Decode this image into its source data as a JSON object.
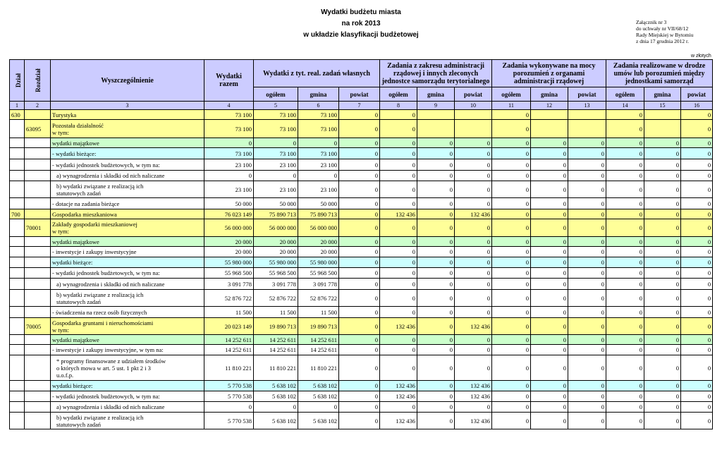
{
  "header": {
    "title_line1": "Wydatki budżetu miasta",
    "title_line2": "na rok 2013",
    "title_line3": "w układzie klasyfikacji budżetowej",
    "annex_line1": "Załącznik nr 3",
    "annex_line2": "do uchwały nr VII/68/12",
    "annex_line3": "Rady Miejskiej w Bytomiu",
    "annex_line4": "z dnia 17 grudnia 2012 r.",
    "unit": "w złotych"
  },
  "table": {
    "col_dzial": "Dział",
    "col_rozdzial": "Rozdział",
    "col_desc": "Wyszczególnienie",
    "col_total": "Wydatki razem",
    "group_own": "Wydatki z tyt. real. zadań własnych",
    "group_admin": "Zadania z zakresu administracji rządowej i innych zleconych jednostce samorządu terytorialnego",
    "group_agreements": "Zadania wykonywane na mocy porozumień z organami administracji rządowej",
    "group_jst": "Zadania realizowane w drodze umów lub porozumień między jednostkami samorząd",
    "sub_total": "ogółem",
    "sub_gmina": "gmina",
    "sub_powiat": "powiat",
    "col_numbers": [
      "1",
      "2",
      "3",
      "4",
      "5",
      "6",
      "7",
      "8",
      "9",
      "10",
      "11",
      "12",
      "13",
      "14",
      "15",
      "16"
    ]
  },
  "rows": [
    {
      "style": "y",
      "dzial": "630",
      "rozdzial": "",
      "desc": "Turystyka",
      "v": [
        "73 100",
        "73 100",
        "73 100",
        "0",
        "0",
        "",
        "",
        "0",
        "",
        "",
        "0",
        "",
        "0"
      ],
      "h": 14
    },
    {
      "style": "y",
      "dzial": "",
      "rozdzial": "63095",
      "desc": "Pozostała działalność\nw tym:",
      "v": [
        "73 100",
        "73 100",
        "73 100",
        "0",
        "0",
        "",
        "",
        "0",
        "",
        "",
        "0",
        "",
        "0"
      ],
      "h": 26
    },
    {
      "style": "g",
      "dzial": "",
      "rozdzial": "",
      "desc": "wydatki majątkowe",
      "v": [
        "0",
        "0",
        "0",
        "0",
        "0",
        "0",
        "0",
        "0",
        "0",
        "0",
        "0",
        "0",
        "0"
      ],
      "h": 14
    },
    {
      "style": "c",
      "dzial": "",
      "rozdzial": "",
      "desc": "- wydatki bieżące:",
      "v": [
        "73 100",
        "73 100",
        "73 100",
        "0",
        "0",
        "0",
        "0",
        "0",
        "0",
        "0",
        "0",
        "0",
        "0"
      ],
      "h": 16
    },
    {
      "style": "w",
      "dzial": "",
      "rozdzial": "",
      "desc": "- wydatki jednostek budżetowych, w tym na:",
      "v": [
        "23 100",
        "23 100",
        "23 100",
        "0",
        "0",
        "0",
        "0",
        "0",
        "0",
        "0",
        "0",
        "0",
        "0"
      ],
      "h": 16
    },
    {
      "style": "w",
      "dzial": "",
      "rozdzial": "",
      "desc": "a) wynagrodzenia i składki od nich naliczane",
      "v": [
        "0",
        "0",
        "0",
        "0",
        "0",
        "0",
        "0",
        "0",
        "0",
        "0",
        "0",
        "0",
        "0"
      ],
      "h": 15
    },
    {
      "style": "w",
      "dzial": "",
      "rozdzial": "",
      "desc": "b) wydatki związane z realizacją ich\nstatutowych zadań",
      "v": [
        "23 100",
        "23 100",
        "23 100",
        "0",
        "0",
        "0",
        "0",
        "0",
        "0",
        "0",
        "0",
        "0",
        "0"
      ],
      "h": 24
    },
    {
      "style": "w",
      "dzial": "",
      "rozdzial": "",
      "desc": "- dotacje na zadania bieżące",
      "v": [
        "50 000",
        "50 000",
        "50 000",
        "0",
        "0",
        "0",
        "0",
        "0",
        "0",
        "0",
        "0",
        "0",
        "0"
      ],
      "h": 16
    },
    {
      "style": "y",
      "dzial": "700",
      "rozdzial": "",
      "desc": "Gospodarka mieszkaniowa",
      "v": [
        "76 023 149",
        "75 890 713",
        "75 890 713",
        "0",
        "132 436",
        "0",
        "132 436",
        "0",
        "0",
        "0",
        "0",
        "0",
        "0"
      ],
      "h": 14
    },
    {
      "style": "y",
      "dzial": "",
      "rozdzial": "70001",
      "desc": "Zakłady gospodarki mieszkaniowej\nw tym:",
      "v": [
        "56 000 000",
        "56 000 000",
        "56 000 000",
        "0",
        "0",
        "0",
        "0",
        "0",
        "0",
        "0",
        "0",
        "0",
        "0"
      ],
      "h": 25
    },
    {
      "style": "g",
      "dzial": "",
      "rozdzial": "",
      "desc": "wydatki majątkowe",
      "v": [
        "20 000",
        "20 000",
        "20 000",
        "0",
        "0",
        "0",
        "0",
        "0",
        "0",
        "0",
        "0",
        "0",
        "0"
      ],
      "h": 14
    },
    {
      "style": "w",
      "dzial": "",
      "rozdzial": "",
      "desc": "- inwestycje i zakupy inwestycyjne",
      "v": [
        "20 000",
        "20 000",
        "20 000",
        "0",
        "0",
        "0",
        "0",
        "0",
        "0",
        "0",
        "0",
        "0",
        "0"
      ],
      "h": 15
    },
    {
      "style": "c",
      "dzial": "",
      "rozdzial": "",
      "desc": "wydatki bieżące:",
      "v": [
        "55 980 000",
        "55 980 000",
        "55 980 000",
        "0",
        "0",
        "0",
        "0",
        "0",
        "0",
        "0",
        "0",
        "0",
        "0"
      ],
      "h": 15
    },
    {
      "style": "w",
      "dzial": "",
      "rozdzial": "",
      "desc": "- wydatki jednostek budżetowych, w tym na:",
      "v": [
        "55 968 500",
        "55 968 500",
        "55 968 500",
        "0",
        "0",
        "0",
        "0",
        "0",
        "0",
        "0",
        "0",
        "0",
        "0"
      ],
      "h": 15
    },
    {
      "style": "w",
      "dzial": "",
      "rozdzial": "",
      "desc": "a) wynagrodzenia i składki od nich naliczane",
      "v": [
        "3 091 778",
        "3 091 778",
        "3 091 778",
        "0",
        "0",
        "0",
        "0",
        "0",
        "0",
        "0",
        "0",
        "0",
        "0"
      ],
      "h": 16
    },
    {
      "style": "w",
      "dzial": "",
      "rozdzial": "",
      "desc": "b) wydatki związane z realizacją ich\nstatutowych zadań",
      "v": [
        "52 876 722",
        "52 876 722",
        "52 876 722",
        "0",
        "0",
        "0",
        "0",
        "0",
        "0",
        "0",
        "0",
        "0",
        "0"
      ],
      "h": 24
    },
    {
      "style": "w",
      "dzial": "",
      "rozdzial": "",
      "desc": "- świadczenia na rzecz osób fizycznych",
      "v": [
        "11 500",
        "11 500",
        "11 500",
        "0",
        "0",
        "0",
        "0",
        "0",
        "0",
        "0",
        "0",
        "0",
        "0"
      ],
      "h": 16
    },
    {
      "style": "y",
      "dzial": "",
      "rozdzial": "70005",
      "desc": "Gospodarka gruntami i nieruchomościami\nw tym:",
      "v": [
        "20 023 149",
        "19 890 713",
        "19 890 713",
        "0",
        "132 436",
        "0",
        "132 436",
        "0",
        "0",
        "0",
        "0",
        "0",
        "0"
      ],
      "h": 24
    },
    {
      "style": "g",
      "dzial": "",
      "rozdzial": "",
      "desc": "wydatki majątkowe",
      "v": [
        "14 252 611",
        "14 252 611",
        "14 252 611",
        "0",
        "0",
        "0",
        "0",
        "0",
        "0",
        "0",
        "0",
        "0",
        "0"
      ],
      "h": 14
    },
    {
      "style": "w",
      "dzial": "",
      "rozdzial": "",
      "desc": "- inwestycje i zakupy inwestycyjne, w tym na:",
      "v": [
        "14 252 611",
        "14 252 611",
        "14 252 611",
        "0",
        "0",
        "0",
        "0",
        "0",
        "0",
        "0",
        "0",
        "0",
        "0"
      ],
      "h": 15
    },
    {
      "style": "w",
      "dzial": "",
      "rozdzial": "",
      "desc": "* programy finansowane z udziałem środków\no których mowa w art. 5 ust. 1 pkt 2 i 3\nu.o.f.p.",
      "v": [
        "11 810 221",
        "11 810 221",
        "11 810 221",
        "0",
        "0",
        "0",
        "0",
        "0",
        "0",
        "0",
        "0",
        "0",
        "0"
      ],
      "h": 36
    },
    {
      "style": "c",
      "dzial": "",
      "rozdzial": "",
      "desc": "wydatki bieżące:",
      "v": [
        "5 770 538",
        "5 638 102",
        "5 638 102",
        "0",
        "132 436",
        "0",
        "132 436",
        "0",
        "0",
        "0",
        "0",
        "0",
        "0"
      ],
      "h": 15
    },
    {
      "style": "w",
      "dzial": "",
      "rozdzial": "",
      "desc": "- wydatki jednostek budżetowych, w tym na:",
      "v": [
        "5 770 538",
        "5 638 102",
        "5 638 102",
        "0",
        "132 436",
        "0",
        "132 436",
        "0",
        "0",
        "0",
        "0",
        "0",
        "0"
      ],
      "h": 15
    },
    {
      "style": "w",
      "dzial": "",
      "rozdzial": "",
      "desc": "a) wynagrodzenia i składki od nich naliczane",
      "v": [
        "0",
        "0",
        "0",
        "0",
        "0",
        "0",
        "0",
        "0",
        "0",
        "0",
        "0",
        "0",
        "0"
      ],
      "h": 15
    },
    {
      "style": "w",
      "dzial": "",
      "rozdzial": "",
      "desc": "b) wydatki związane z realizacją ich\nstatutowych zadań",
      "v": [
        "5 770 538",
        "5 638 102",
        "5 638 102",
        "0",
        "132 436",
        "0",
        "132 436",
        "0",
        "0",
        "0",
        "0",
        "0",
        "0"
      ],
      "h": 24
    }
  ]
}
